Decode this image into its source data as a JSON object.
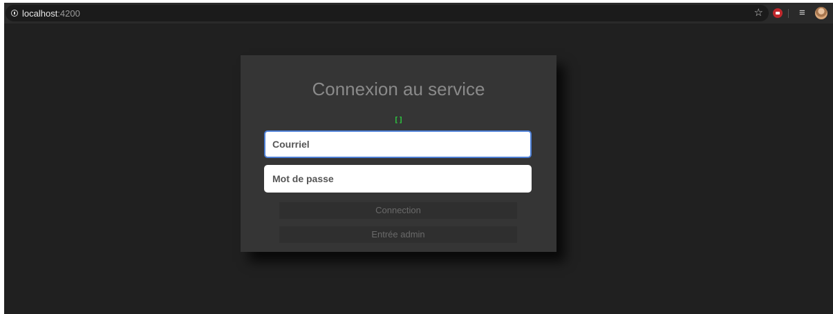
{
  "browser": {
    "url_host": "localhost",
    "url_port": ":4200",
    "icons": {
      "info": "info-icon",
      "bookmark": "star-icon",
      "extension": "ublock-icon",
      "media": "queue-icon",
      "profile": "avatar"
    }
  },
  "login": {
    "title": "Connexion au service",
    "status_text": "[]",
    "email_placeholder": "Courriel",
    "password_placeholder": "Mot de passe",
    "connect_label": "Connection",
    "admin_label": "Entrée admin"
  },
  "colors": {
    "page_background": "#202020",
    "card_background": "#353535",
    "status_green": "#2ecc40",
    "focus_border": "#4d7fd6"
  }
}
